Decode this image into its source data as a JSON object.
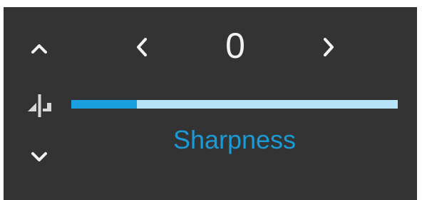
{
  "control": {
    "value": "0",
    "label": "Sharpness",
    "slider_level_fraction": 0.2
  },
  "icons": {
    "up": "chevron-up-icon",
    "down": "chevron-down-icon",
    "prev": "chevron-left-icon",
    "next": "chevron-right-icon",
    "compare": "split-compare-icon"
  },
  "colors": {
    "panel_background": "#333333",
    "value_text": "#f2f2f2",
    "label_text": "#1a9ad6",
    "slider_fill": "#1aa0e0",
    "slider_track": "#b7e3f6"
  }
}
